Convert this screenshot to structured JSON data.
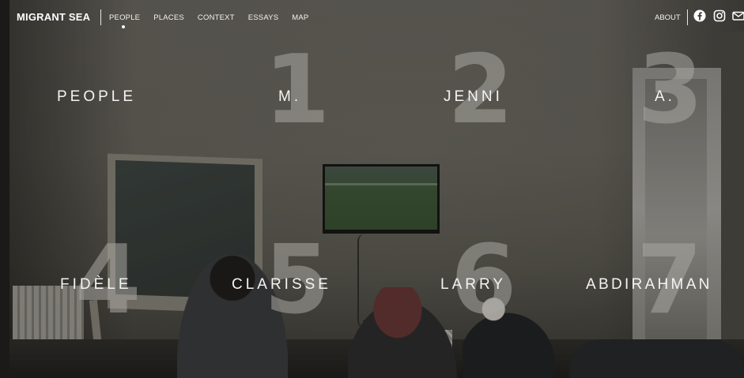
{
  "header": {
    "brand": "MIGRANT SEA",
    "nav": [
      "PEOPLE",
      "PLACES",
      "CONTEXT",
      "ESSAYS",
      "MAP"
    ],
    "about": "ABOUT",
    "social_icons": [
      "facebook-icon",
      "instagram-icon",
      "mail-icon"
    ]
  },
  "grid": {
    "heading": "PEOPLE",
    "people": [
      {
        "number": "1",
        "name": "M."
      },
      {
        "number": "2",
        "name": "JENNI"
      },
      {
        "number": "3",
        "name": "A."
      },
      {
        "number": "4",
        "name": "FIDÈLE"
      },
      {
        "number": "5",
        "name": "CLARISSE"
      },
      {
        "number": "6",
        "name": "LARRY"
      },
      {
        "number": "7",
        "name": "ABDIRAHMAN"
      }
    ]
  },
  "colors": {
    "text": "#ffffff",
    "numerals": "#aaa8a2"
  }
}
